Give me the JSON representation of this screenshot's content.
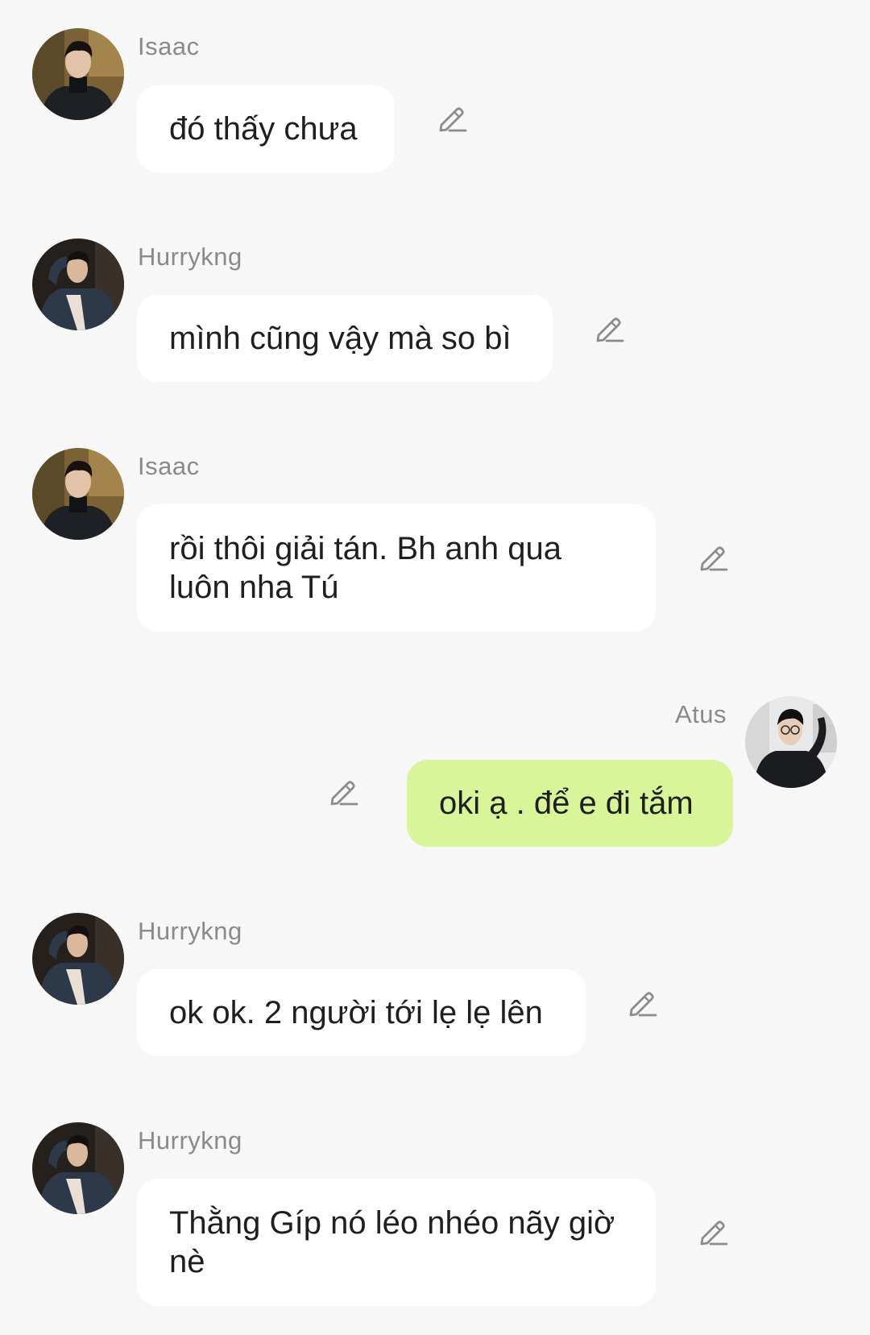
{
  "messages": [
    {
      "sender": "Isaac",
      "text": "đó thấy chưa",
      "direction": "incoming",
      "avatar": "isaac-avatar"
    },
    {
      "sender": "Hurrykng",
      "text": "mình cũng vậy mà so bì",
      "direction": "incoming",
      "avatar": "hurrykng-avatar"
    },
    {
      "sender": "Isaac",
      "text": "rồi thôi giải tán. Bh anh qua luôn nha Tú",
      "direction": "incoming",
      "avatar": "isaac-avatar"
    },
    {
      "sender": "Atus",
      "text": "oki ạ . để e đi tắm",
      "direction": "outgoing",
      "avatar": "atus-avatar"
    },
    {
      "sender": "Hurrykng",
      "text": "ok ok. 2 người tới lẹ lẹ lên",
      "direction": "incoming",
      "avatar": "hurrykng-avatar"
    },
    {
      "sender": "Hurrykng",
      "text": "Thằng Gíp nó léo nhéo nãy giờ nè",
      "direction": "incoming",
      "avatar": "hurrykng-avatar"
    }
  ],
  "colors": {
    "background": "#f7f7f7",
    "incoming_bubble": "#ffffff",
    "outgoing_bubble": "#d9f59a",
    "sender_name": "#8a8a8a",
    "message_text": "#1f1f1f",
    "edit_icon": "#8c8c8c"
  },
  "icons": {
    "edit": "pencil-edit-icon"
  }
}
